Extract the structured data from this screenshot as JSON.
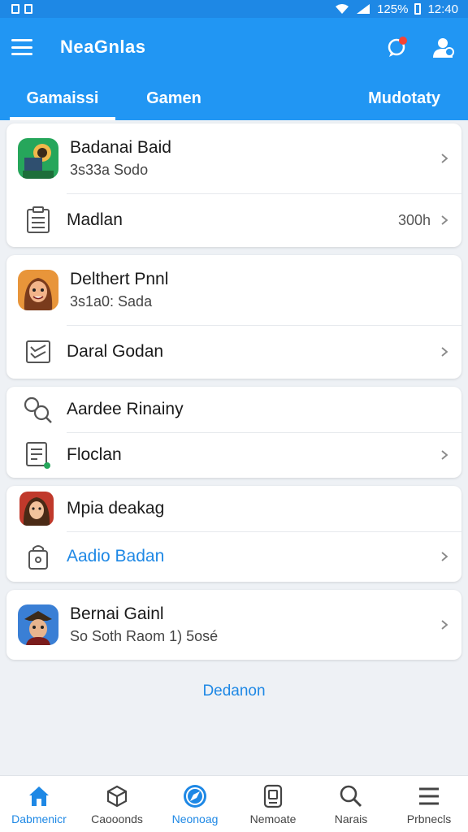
{
  "status_bar": {
    "battery": "125%",
    "time": "12:40"
  },
  "app_bar": {
    "title": "NeaGnlas",
    "menu_icon": "hamburger-icon",
    "chat_icon": "chat-notification-icon",
    "profile_icon": "user-profile-icon"
  },
  "tabs": [
    {
      "label": "Gamaissi",
      "active": true
    },
    {
      "label": "Gamen",
      "active": false
    },
    {
      "label": "Mudotaty",
      "active": false
    }
  ],
  "cards": [
    {
      "rows": [
        {
          "icon": "game-app-icon-1",
          "title": "Badanai Baid",
          "subtitle": "3s33a Sodo",
          "value": "",
          "chevron": true
        },
        {
          "icon": "document-icon",
          "title": "Madlan",
          "subtitle": "",
          "value": "300h",
          "chevron": true
        }
      ]
    },
    {
      "rows": [
        {
          "icon": "game-app-icon-2",
          "title": "Delthert Pnnl",
          "subtitle": "3s1a0: Sada",
          "value": "",
          "chevron": false
        },
        {
          "icon": "checklist-icon",
          "title": "Daral Godan",
          "subtitle": "",
          "value": "",
          "chevron": true
        }
      ]
    },
    {
      "rows": [
        {
          "icon": "search-key-icon",
          "title": "Aardee Rinainy",
          "subtitle": "",
          "value": "",
          "chevron": false
        },
        {
          "icon": "edit-document-icon",
          "title": "Floclan",
          "subtitle": "",
          "value": "",
          "chevron": true
        }
      ]
    },
    {
      "rows": [
        {
          "icon": "game-app-icon-3",
          "title": "Mpia deakag",
          "subtitle": "",
          "value": "",
          "chevron": false
        },
        {
          "icon": "lock-icon",
          "title": "Aadio Badan",
          "subtitle": "",
          "value": "",
          "chevron": true,
          "link": true
        }
      ]
    },
    {
      "rows": [
        {
          "icon": "game-app-icon-4",
          "title": "Bernai Gainl",
          "subtitle": "So Soth Raom 1) 5osé",
          "value": "",
          "chevron": true
        }
      ]
    }
  ],
  "footer_link": "Dedanon",
  "bottom_nav": [
    {
      "label": "Dabmenicr",
      "icon": "home-icon",
      "active": true
    },
    {
      "label": "Caooonds",
      "icon": "cube-icon",
      "active": false
    },
    {
      "label": "Neonoag",
      "icon": "compass-icon",
      "active": true
    },
    {
      "label": "Nemoate",
      "icon": "device-icon",
      "active": false
    },
    {
      "label": "Narais",
      "icon": "search-icon",
      "active": false
    },
    {
      "label": "Prbnecls",
      "icon": "list-icon",
      "active": false
    }
  ],
  "colors": {
    "primary": "#2196f3",
    "accent": "#1e88e5",
    "badge": "#f44336"
  }
}
